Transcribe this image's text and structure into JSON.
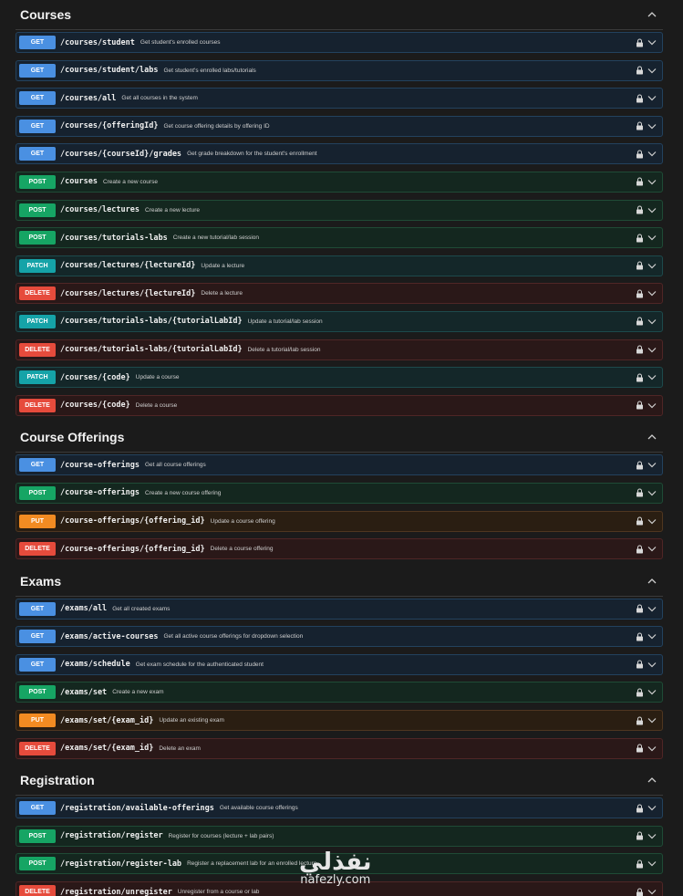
{
  "sections": [
    {
      "title": "Courses",
      "ops": [
        {
          "method": "GET",
          "cls": "get",
          "path": "/courses/student",
          "desc": "Get student's enrolled courses"
        },
        {
          "method": "GET",
          "cls": "get",
          "path": "/courses/student/labs",
          "desc": "Get student's enrolled labs/tutorials"
        },
        {
          "method": "GET",
          "cls": "get",
          "path": "/courses/all",
          "desc": "Get all courses in the system"
        },
        {
          "method": "GET",
          "cls": "get",
          "path": "/courses/{offeringId}",
          "desc": "Get course offering details by offering ID"
        },
        {
          "method": "GET",
          "cls": "get",
          "path": "/courses/{courseId}/grades",
          "desc": "Get grade breakdown for the student's enrollment"
        },
        {
          "method": "POST",
          "cls": "post",
          "path": "/courses",
          "desc": "Create a new course"
        },
        {
          "method": "POST",
          "cls": "post",
          "path": "/courses/lectures",
          "desc": "Create a new lecture"
        },
        {
          "method": "POST",
          "cls": "post",
          "path": "/courses/tutorials-labs",
          "desc": "Create a new tutorial/lab session"
        },
        {
          "method": "PATCH",
          "cls": "patch",
          "path": "/courses/lectures/{lectureId}",
          "desc": "Update a lecture"
        },
        {
          "method": "DELETE",
          "cls": "delete",
          "path": "/courses/lectures/{lectureId}",
          "desc": "Delete a lecture"
        },
        {
          "method": "PATCH",
          "cls": "patch",
          "path": "/courses/tutorials-labs/{tutorialLabId}",
          "desc": "Update a tutorial/lab session"
        },
        {
          "method": "DELETE",
          "cls": "delete",
          "path": "/courses/tutorials-labs/{tutorialLabId}",
          "desc": "Delete a tutorial/lab session"
        },
        {
          "method": "PATCH",
          "cls": "patch",
          "path": "/courses/{code}",
          "desc": "Update a course"
        },
        {
          "method": "DELETE",
          "cls": "delete",
          "path": "/courses/{code}",
          "desc": "Delete a course"
        }
      ]
    },
    {
      "title": "Course Offerings",
      "ops": [
        {
          "method": "GET",
          "cls": "get",
          "path": "/course-offerings",
          "desc": "Get all course offerings"
        },
        {
          "method": "POST",
          "cls": "post",
          "path": "/course-offerings",
          "desc": "Create a new course offering"
        },
        {
          "method": "PUT",
          "cls": "put",
          "path": "/course-offerings/{offering_id}",
          "desc": "Update a course offering"
        },
        {
          "method": "DELETE",
          "cls": "delete",
          "path": "/course-offerings/{offering_id}",
          "desc": "Delete a course offering"
        }
      ]
    },
    {
      "title": "Exams",
      "ops": [
        {
          "method": "GET",
          "cls": "get",
          "path": "/exams/all",
          "desc": "Get all created exams"
        },
        {
          "method": "GET",
          "cls": "get",
          "path": "/exams/active-courses",
          "desc": "Get all active course offerings for dropdown selection"
        },
        {
          "method": "GET",
          "cls": "get",
          "path": "/exams/schedule",
          "desc": "Get exam schedule for the authenticated student"
        },
        {
          "method": "POST",
          "cls": "post",
          "path": "/exams/set",
          "desc": "Create a new exam"
        },
        {
          "method": "PUT",
          "cls": "put",
          "path": "/exams/set/{exam_id}",
          "desc": "Update an existing exam"
        },
        {
          "method": "DELETE",
          "cls": "delete",
          "path": "/exams/set/{exam_id}",
          "desc": "Delete an exam"
        }
      ]
    },
    {
      "title": "Registration",
      "ops": [
        {
          "method": "GET",
          "cls": "get",
          "path": "/registration/available-offerings",
          "desc": "Get available course offerings"
        },
        {
          "method": "POST",
          "cls": "post",
          "path": "/registration/register",
          "desc": "Register for courses (lecture + lab pairs)"
        },
        {
          "method": "POST",
          "cls": "post",
          "path": "/registration/register-lab",
          "desc": "Register a replacement lab for an enrolled lecture"
        },
        {
          "method": "DELETE",
          "cls": "delete",
          "path": "/registration/unregister",
          "desc": "Unregister from a course or lab"
        }
      ]
    }
  ],
  "icons": {
    "lock": "lock-icon",
    "expand": "chevron-down-icon",
    "collapse": "chevron-up-icon"
  },
  "watermark": {
    "arabic": "نفذلي",
    "latin": "nafezly.com"
  }
}
